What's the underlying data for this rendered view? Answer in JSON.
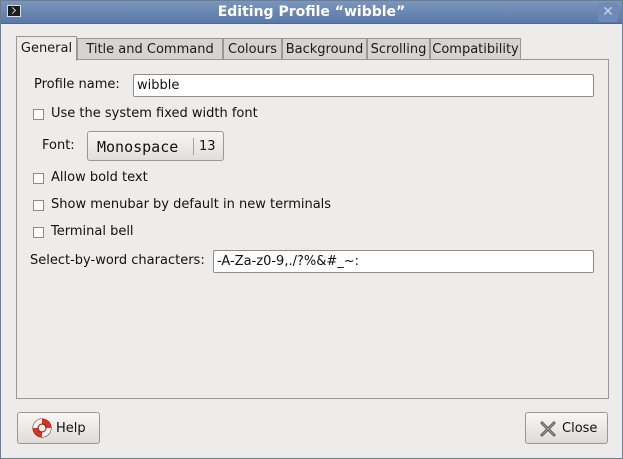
{
  "window": {
    "title": "Editing Profile “wibble”",
    "close_glyph": "✕"
  },
  "tabs": [
    {
      "label": "General",
      "active": true
    },
    {
      "label": "Title and Command",
      "active": false
    },
    {
      "label": "Colours",
      "active": false
    },
    {
      "label": "Background",
      "active": false
    },
    {
      "label": "Scrolling",
      "active": false
    },
    {
      "label": "Compatibility",
      "active": false
    }
  ],
  "general": {
    "profile_name_label": "Profile name:",
    "profile_name_value": "wibble",
    "system_font_label": "Use the system fixed width font",
    "system_font_checked": false,
    "font_label": "Font:",
    "font_name": "Monospace",
    "font_size": "13",
    "bold_label": "Allow bold text",
    "bold_checked": false,
    "menubar_label": "Show menubar by default in new terminals",
    "menubar_checked": false,
    "bell_label": "Terminal bell",
    "bell_checked": false,
    "word_chars_label": "Select-by-word characters:",
    "word_chars_value": "-A-Za-z0-9,./?%&#_~:"
  },
  "buttons": {
    "help_label": "Help",
    "close_label": "Close"
  },
  "icons": {
    "window_icon": "terminal-icon",
    "help_icon": "lifebuoy-icon",
    "close_icon": "x-icon"
  }
}
